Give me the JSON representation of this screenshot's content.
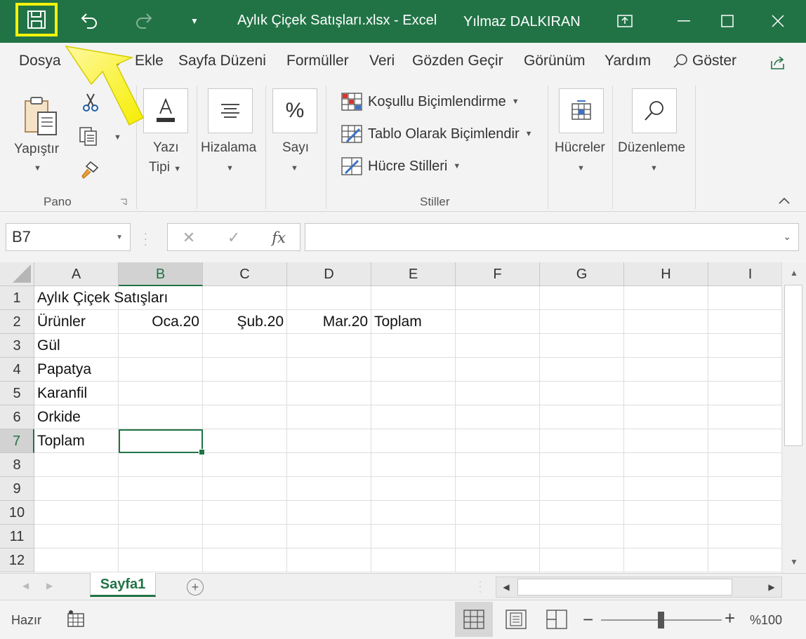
{
  "titlebar": {
    "title": "Aylık Çiçek Satışları.xlsx  -  Excel",
    "user": "Yılmaz DALKIRAN",
    "icons": [
      "save-icon",
      "undo-icon",
      "redo-icon",
      "customize-qat-icon",
      "ribbon-display-icon",
      "minimize-icon",
      "maximize-icon",
      "close-icon"
    ]
  },
  "tabs": {
    "items": [
      "Dosya",
      "Giriş",
      "Ekle",
      "Sayfa Düzeni",
      "Formüller",
      "Veri",
      "Gözden Geçir",
      "Görünüm",
      "Yardım"
    ],
    "active": "Giriş",
    "search_label": "Göster"
  },
  "ribbon": {
    "paste_label": "Yapıştır",
    "clipboard_group": "Pano",
    "font_label_1": "Yazı",
    "font_label_2": "Tipi",
    "alignment_label": "Hizalama",
    "number_label": "Sayı",
    "number_icon_glyph": "%",
    "styles": {
      "conditional": "Koşullu Biçimlendirme",
      "table": "Tablo Olarak Biçimlendir",
      "cell_styles": "Hücre Stilleri",
      "group": "Stiller"
    },
    "cells_label": "Hücreler",
    "editing_label": "Düzenleme"
  },
  "formula_bar": {
    "name_box": "B7",
    "cancel_glyph": "✕",
    "enter_glyph": "✓",
    "fx_label": "fx",
    "value": ""
  },
  "grid": {
    "columns": [
      "A",
      "B",
      "C",
      "D",
      "E",
      "F",
      "G",
      "H",
      "I"
    ],
    "rows": [
      "1",
      "2",
      "3",
      "4",
      "5",
      "6",
      "7",
      "8",
      "9",
      "10",
      "11",
      "12"
    ],
    "selected_column": "B",
    "selected_row": "7",
    "cells": {
      "A1": "Aylık Çiçek Satışları",
      "A2": "Ürünler",
      "B2": "Oca.20",
      "C2": "Şub.20",
      "D2": "Mar.20",
      "E2": "Toplam",
      "A3": "Gül",
      "A4": "Papatya",
      "A5": "Karanfil",
      "A6": "Orkide",
      "A7": "Toplam"
    }
  },
  "sheets": {
    "tabs": [
      "Sayfa1"
    ],
    "active": "Sayfa1"
  },
  "status": {
    "text": "Hazır",
    "zoom": "%100",
    "zoom_percent": 100
  },
  "colors": {
    "accent": "#217346",
    "highlight": "#f2f20a"
  }
}
